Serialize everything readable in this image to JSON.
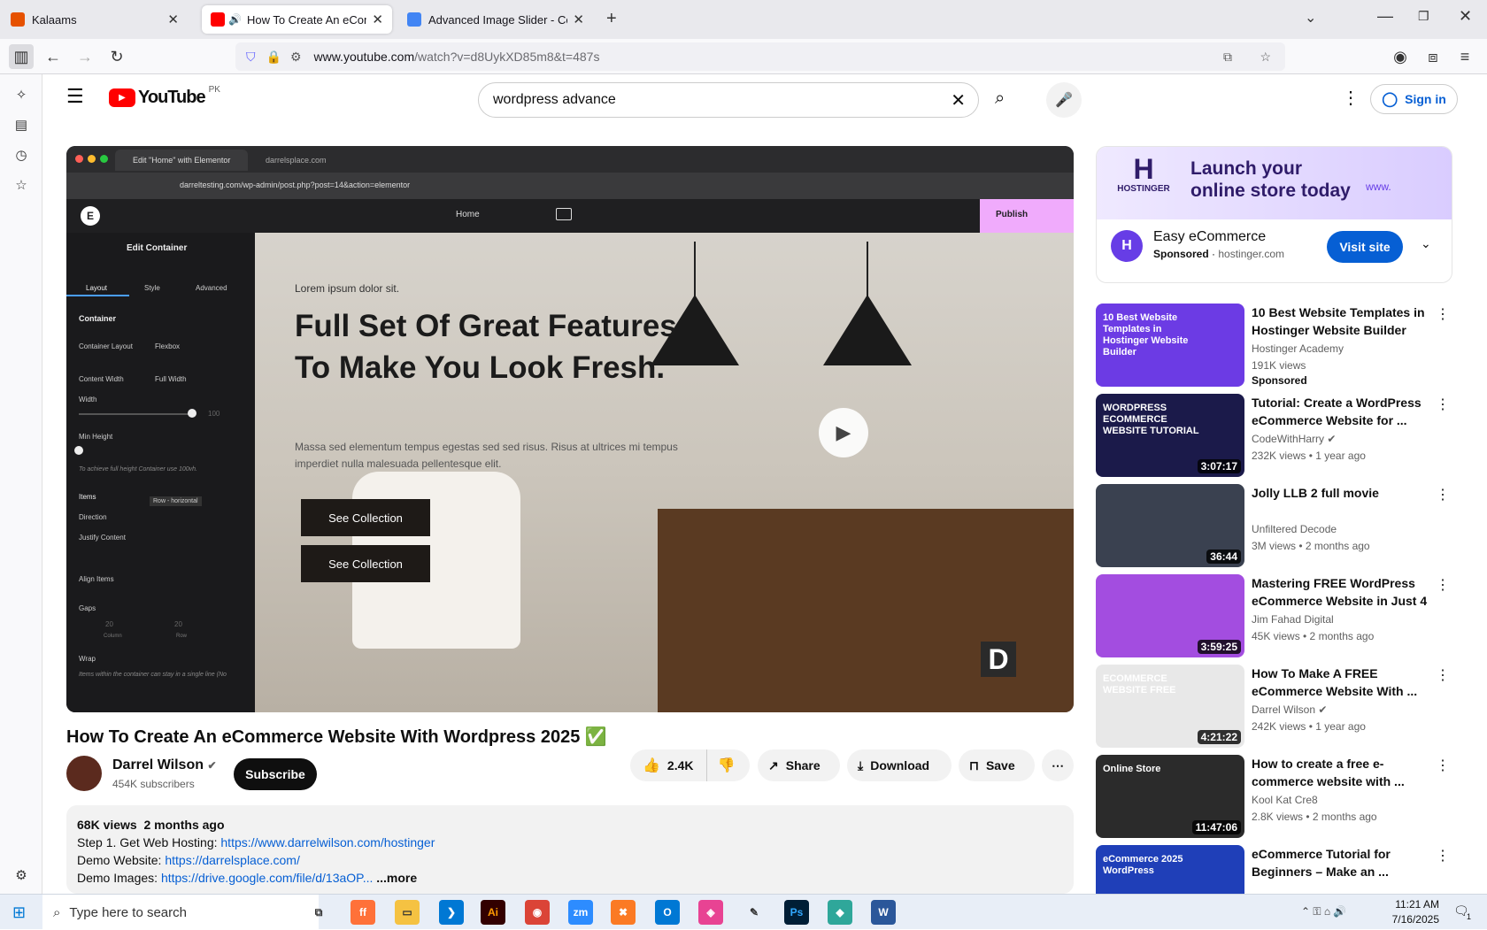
{
  "browser": {
    "tabs": [
      {
        "title": "Kalaams",
        "active": false,
        "favicon_color": "#e65100"
      },
      {
        "title": "How To Create An eComme",
        "active": true,
        "favicon_color": "#ff0000"
      },
      {
        "title": "Advanced Image Slider - Code",
        "active": false,
        "favicon_color": "#4285f4"
      }
    ],
    "url_domain": "www.youtube.com",
    "url_path": "/watch?v=d8UykXD85m8&t=487s"
  },
  "youtube": {
    "logo_text": "YouTube",
    "region": "PK",
    "search_value": "wordpress advance",
    "signin_label": "Sign in"
  },
  "player": {
    "editor_tab1": "Edit \"Home\" with Elementor",
    "editor_tab2": "darrelsplace.com",
    "editor_url": "darreltesting.com/wp-admin/post.php?post=14&action=elementor",
    "home_label": "Home",
    "publish_label": "Publish",
    "panel_title": "Edit Container",
    "panel_tabs": [
      "Layout",
      "Style",
      "Advanced"
    ],
    "section": "Container",
    "fields": [
      {
        "label": "Container Layout",
        "value": "Flexbox"
      },
      {
        "label": "Content Width",
        "value": "Full Width"
      },
      {
        "label": "Width",
        "value": "100"
      },
      {
        "label": "Min Height",
        "value": ""
      }
    ],
    "hint": "To achieve full height Container use 100vh.",
    "items_label": "Items",
    "direction_label": "Direction",
    "direction_tooltip": "Row - horizontal",
    "justify_label": "Justify Content",
    "align_label": "Align Items",
    "gaps_label": "Gaps",
    "gap_values": [
      "20",
      "20"
    ],
    "gap_sub": [
      "Column",
      "Row"
    ],
    "wrap_label": "Wrap",
    "wrap_hint": "Items within the container can stay in a single line (No",
    "canvas_small": "Lorem ipsum dolor sit.",
    "canvas_heading": "Full Set Of Great Features To Make You Look Fresh.",
    "canvas_body": "Massa sed elementum tempus egestas sed sed risus. Risus at ultrices mi tempus imperdiet nulla malesuada pellentesque elit.",
    "button1": "See Collection",
    "button2": "See Collection",
    "watermark": "D"
  },
  "video": {
    "title": "How To Create An eCommerce Website With Wordpress 2025",
    "title_emoji": "✅",
    "channel": "Darrel Wilson",
    "subscribers": "454K subscribers",
    "subscribe_label": "Subscribe",
    "likes": "2.4K",
    "share_label": "Share",
    "download_label": "Download",
    "save_label": "Save",
    "views": "68K views",
    "age": "2 months ago",
    "desc_lines": [
      {
        "label": "Step 1. Get Web Hosting: ",
        "link": "https://www.darrelwilson.com/hostinger"
      },
      {
        "label": "Demo Website: ",
        "link": "https://darrelsplace.com/"
      },
      {
        "label": "Demo Images: ",
        "link": "https://drive.google.com/file/d/13aOP..."
      }
    ],
    "more_label": "...more"
  },
  "ad": {
    "brand": "HOSTINGER",
    "banner_line1": "Launch your",
    "banner_line2": "online store today",
    "banner_www": "www.",
    "title": "Easy eCommerce",
    "sponsored": "Sponsored",
    "domain": "hostinger.com",
    "cta": "Visit site"
  },
  "recommendations": [
    {
      "title": "10 Best Website Templates in Hostinger Website Builder",
      "channel": "Hostinger Academy",
      "meta": "191K views",
      "badge": "Sponsored",
      "duration": "",
      "thumb_text": "10 Best Website Templates in Hostinger Website Builder",
      "thumb_color": "#6c3be4"
    },
    {
      "title": "Tutorial: Create a WordPress eCommerce Website for ...",
      "channel": "CodeWithHarry",
      "verified": true,
      "meta": "232K views • 1 year ago",
      "duration": "3:07:17",
      "thumb_text": "WORDPRESS ECOMMERCE WEBSITE TUTORIAL",
      "thumb_color": "#1b1a4a"
    },
    {
      "title": "Jolly LLB 2 full movie",
      "channel": "Unfiltered Decode",
      "meta": "3M views • 2 months ago",
      "duration": "36:44",
      "thumb_text": "",
      "thumb_color": "#3a4150"
    },
    {
      "title": "Mastering FREE WordPress eCommerce Website in Just 4 ...",
      "channel": "Jim Fahad Digital",
      "meta": "45K views • 2 months ago",
      "duration": "3:59:25",
      "thumb_text": "",
      "thumb_color": "#a34de0"
    },
    {
      "title": "How To Make A FREE eCommerce Website With ...",
      "channel": "Darrel Wilson",
      "verified": true,
      "meta": "242K views • 1 year ago",
      "duration": "4:21:22",
      "thumb_text": "ECOMMERCE WEBSITE FREE",
      "thumb_color": "#e8e8e8"
    },
    {
      "title": "How to create a free e-commerce website with ...",
      "channel": "Kool Kat Cre8",
      "meta": "2.8K views • 2 months ago",
      "duration": "11:47:06",
      "thumb_text": "Online Store",
      "thumb_color": "#2b2b2b"
    },
    {
      "title": "eCommerce Tutorial for Beginners – Make an ...",
      "channel": "",
      "meta": "",
      "duration": "",
      "thumb_text": "eCommerce 2025 WordPress",
      "thumb_color": "#1f3fb8"
    }
  ],
  "taskbar": {
    "search_placeholder": "Type here to search",
    "time": "11:21 AM",
    "date": "7/16/2025",
    "notif_count": "1"
  }
}
